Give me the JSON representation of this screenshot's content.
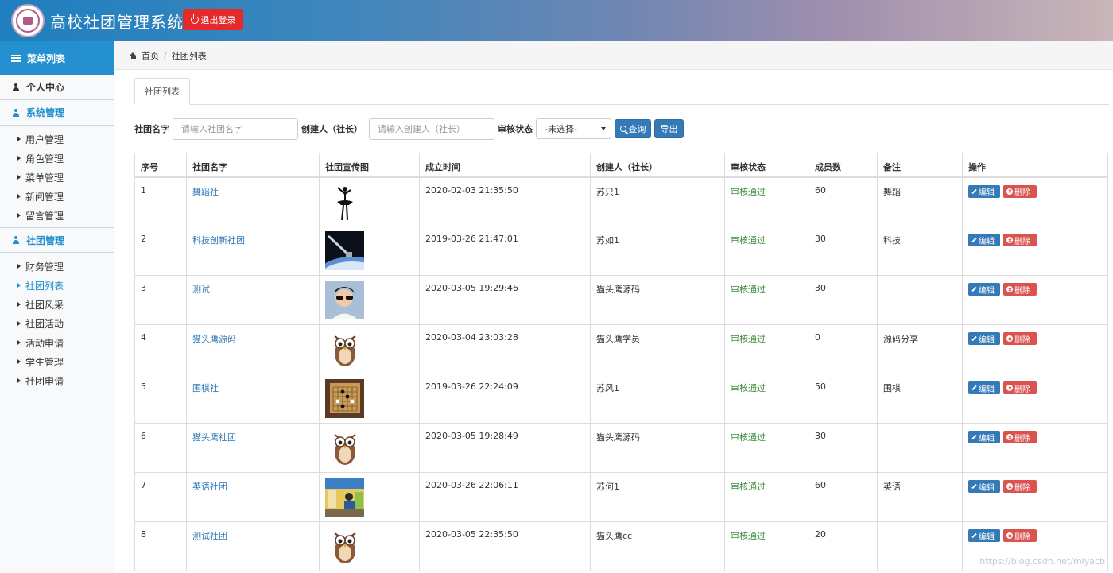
{
  "header": {
    "title": "高校社团管理系统",
    "logout_label": "退出登录",
    "logo_icon": "university-seal-icon"
  },
  "sidebar": {
    "menu_title": "菜单列表",
    "profile": "个人中心",
    "groups": [
      {
        "label": "系统管理",
        "items": [
          "用户管理",
          "角色管理",
          "菜单管理",
          "新闻管理",
          "留言管理"
        ]
      },
      {
        "label": "社团管理",
        "items": [
          "财务管理",
          "社团列表",
          "社团风采",
          "社团活动",
          "活动申请",
          "学生管理",
          "社团申请"
        ]
      }
    ],
    "active_item": "社团列表"
  },
  "breadcrumb": {
    "home": "首页",
    "current": "社团列表"
  },
  "tab": {
    "label": "社团列表"
  },
  "search": {
    "name_label": "社团名字",
    "name_placeholder": "请输入社团名字",
    "creator_label": "创建人（社长）",
    "creator_placeholder": "请输入创建人（社长）",
    "status_label": "审核状态",
    "status_value": "-未选择-",
    "query_label": "查询",
    "export_label": "导出"
  },
  "table": {
    "headers": [
      "序号",
      "社团名字",
      "社团宣传图",
      "成立时间",
      "创建人（社长）",
      "审核状态",
      "成员数",
      "备注",
      "操作"
    ],
    "edit_label": "编辑",
    "delete_label": "删除",
    "rows": [
      {
        "no": "1",
        "name": "舞蹈社",
        "image": "dancer",
        "time": "2020-02-03 21:35:50",
        "creator": "苏只1",
        "status": "审核通过",
        "members": "60",
        "remark": "舞蹈"
      },
      {
        "no": "2",
        "name": "科技创新社团",
        "image": "satellite",
        "time": "2019-03-26 21:47:01",
        "creator": "苏如1",
        "status": "审核通过",
        "members": "30",
        "remark": "科技"
      },
      {
        "no": "3",
        "name": "测试",
        "image": "avatar",
        "time": "2020-03-05 19:29:46",
        "creator": "猫头鹰源码",
        "status": "审核通过",
        "members": "30",
        "remark": ""
      },
      {
        "no": "4",
        "name": "猫头鹰源码",
        "image": "owl",
        "time": "2020-03-04 23:03:28",
        "creator": "猫头鹰学员",
        "status": "审核通过",
        "members": "0",
        "remark": "源码分享"
      },
      {
        "no": "5",
        "name": "围棋社",
        "image": "go-board",
        "time": "2019-03-26 22:24:09",
        "creator": "苏风1",
        "status": "审核通过",
        "members": "50",
        "remark": "围棋"
      },
      {
        "no": "6",
        "name": "猫头鹰社团",
        "image": "owl",
        "time": "2020-03-05 19:28:49",
        "creator": "猫头鹰源码",
        "status": "审核通过",
        "members": "30",
        "remark": ""
      },
      {
        "no": "7",
        "name": "英语社团",
        "image": "classroom",
        "time": "2020-03-26 22:06:11",
        "creator": "苏何1",
        "status": "审核通过",
        "members": "60",
        "remark": "英语"
      },
      {
        "no": "8",
        "name": "测试社团",
        "image": "owl",
        "time": "2020-03-05 22:35:50",
        "creator": "猫头鹰cc",
        "status": "审核通过",
        "members": "20",
        "remark": ""
      }
    ]
  },
  "watermark": "https://blog.csdn.net/mlyacb",
  "colors": {
    "primary": "#337ab7",
    "danger": "#d9534f",
    "sidebar_active": "#2590d0",
    "status_ok": "#3c8a3c"
  }
}
